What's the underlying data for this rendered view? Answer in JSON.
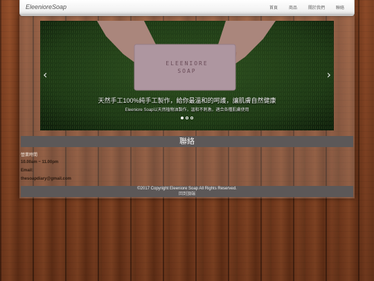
{
  "navbar": {
    "brand": "EleenioreSoap",
    "links": [
      "首頁",
      "商品",
      "關於我們",
      "聯絡"
    ]
  },
  "carousel": {
    "product_text": "ELEENIORE SOAP",
    "caption_title": "天然手工100%純手工製作，給你最溫和的呵護，讓肌膚自然健康",
    "caption_subtitle": "Eleeniore Soap以天然植物油製作，溫和不刺激，適合各種肌膚使用",
    "prev_symbol": "‹",
    "next_symbol": "›",
    "slide_count": 3,
    "active_slide": 1
  },
  "section": {
    "title": "聯絡"
  },
  "contact": {
    "hours_label": "營業時間",
    "hours_value": "10.00am ~ 11.00pm",
    "email_label": "Email:",
    "email_value": "thesoapdiary@gmail.com"
  },
  "footer": {
    "copyright": "©2017 Copyright Eleeniore Soap All Rights Reserved.",
    "link": "回到頂端"
  },
  "colors": {
    "bar": "#5c5858",
    "wood": "#7a3b1d",
    "grass": "#2f4a22"
  }
}
